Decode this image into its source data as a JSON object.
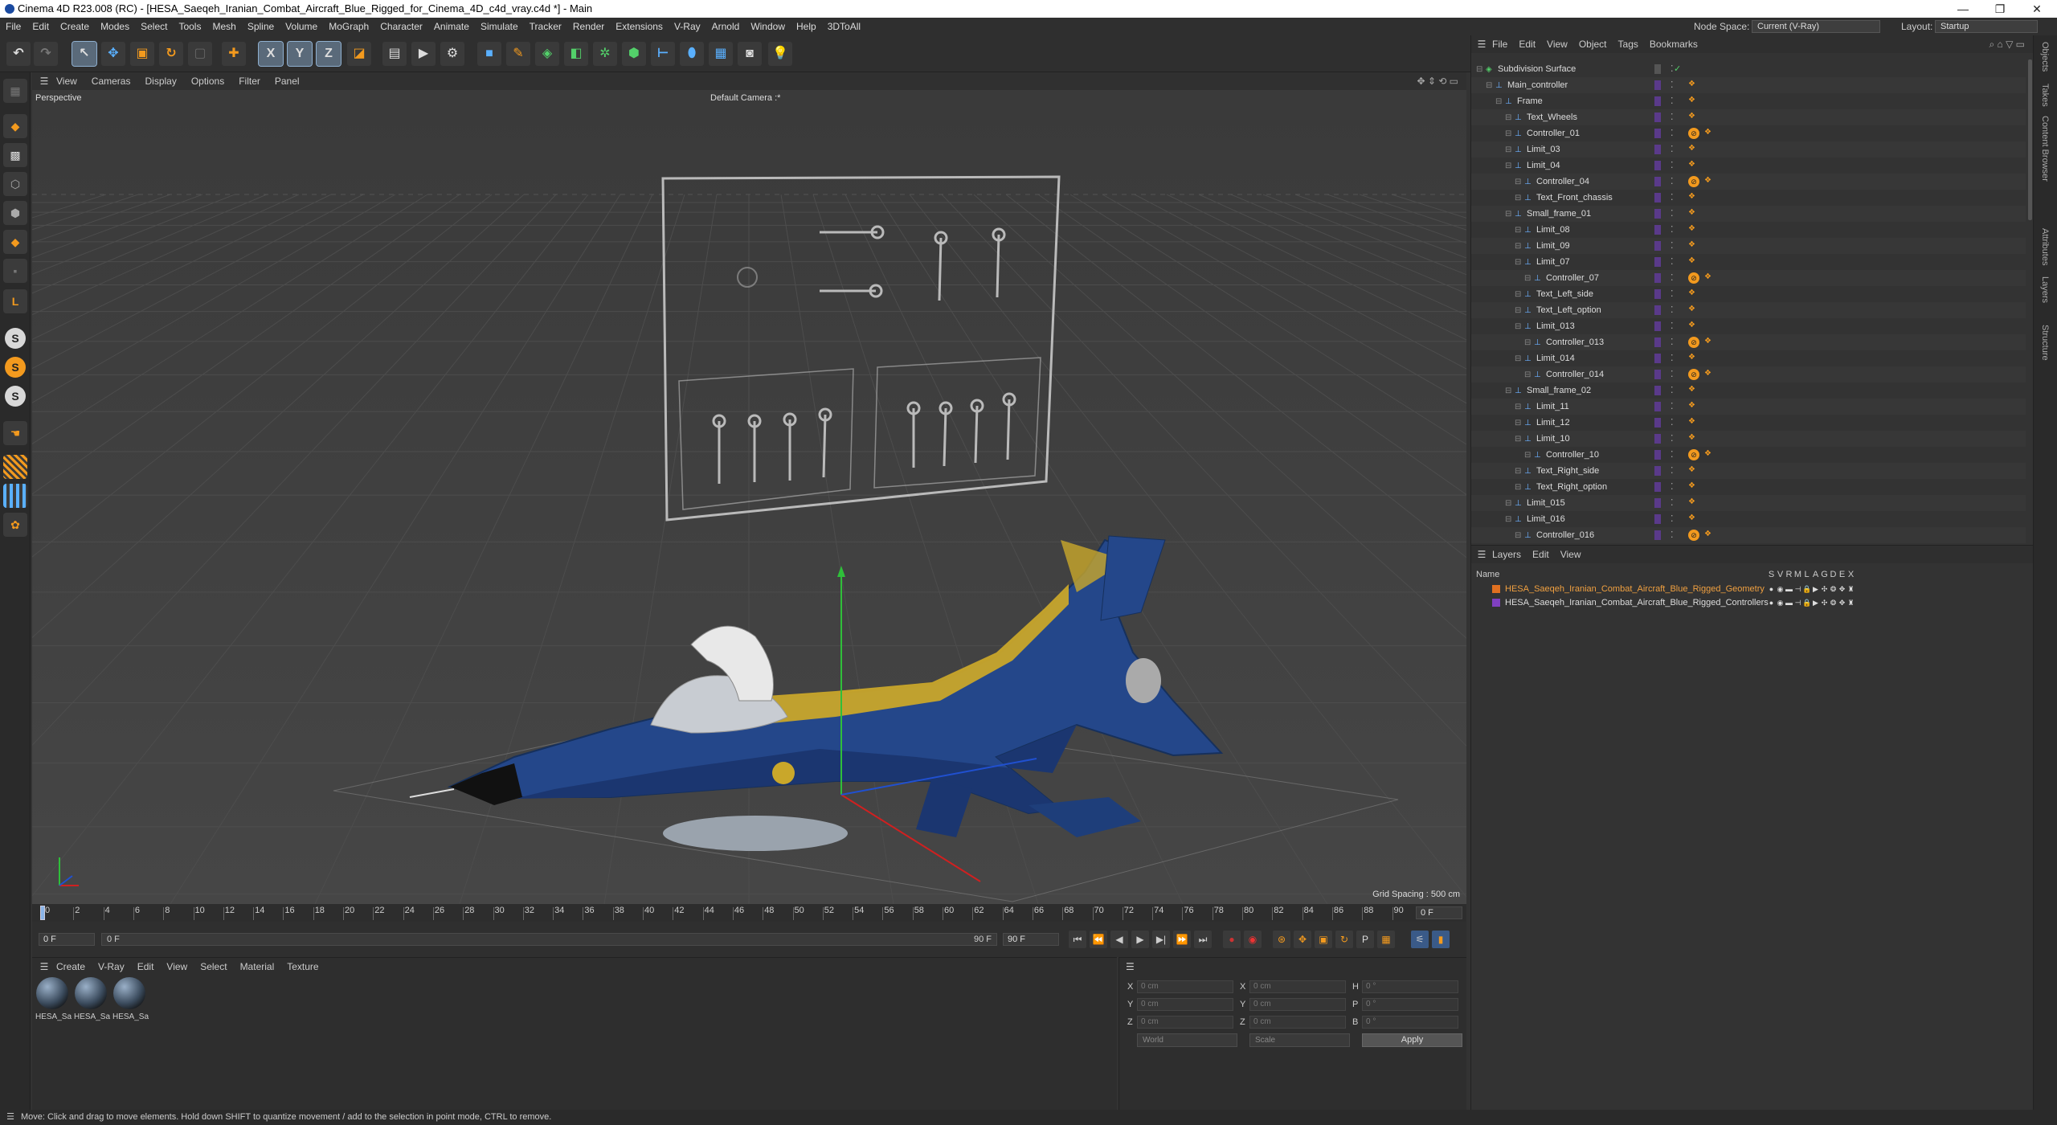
{
  "window": {
    "title": "Cinema 4D R23.008 (RC) - [HESA_Saeqeh_Iranian_Combat_Aircraft_Blue_Rigged_for_Cinema_4D_c4d_vray.c4d *] - Main",
    "minimize": "—",
    "maximize": "❐",
    "close": "✕"
  },
  "menu": {
    "items": [
      "File",
      "Edit",
      "Create",
      "Modes",
      "Select",
      "Tools",
      "Mesh",
      "Spline",
      "Volume",
      "MoGraph",
      "Character",
      "Animate",
      "Simulate",
      "Tracker",
      "Render",
      "Extensions",
      "V-Ray",
      "Arnold",
      "Window",
      "Help",
      "3DToAll"
    ],
    "node_space_label": "Node Space:",
    "node_space_value": "Current (V-Ray)",
    "layout_label": "Layout:",
    "layout_value": "Startup"
  },
  "viewport": {
    "menu": [
      "View",
      "Cameras",
      "Display",
      "Options",
      "Filter",
      "Panel"
    ],
    "view_name": "Perspective",
    "camera": "Default Camera :*",
    "grid_spacing": "Grid Spacing : 500 cm"
  },
  "timeline": {
    "ticks": [
      "0",
      "2",
      "4",
      "6",
      "8",
      "10",
      "12",
      "14",
      "16",
      "18",
      "20",
      "22",
      "24",
      "26",
      "28",
      "30",
      "32",
      "34",
      "36",
      "38",
      "40",
      "42",
      "44",
      "46",
      "48",
      "50",
      "52",
      "54",
      "56",
      "58",
      "60",
      "62",
      "64",
      "66",
      "68",
      "70",
      "72",
      "74",
      "76",
      "78",
      "80",
      "82",
      "84",
      "86",
      "88",
      "90"
    ],
    "current_frame": "0 F"
  },
  "transport": {
    "start": "0 F",
    "current": "0 F",
    "end": "90 F",
    "max": "90 F"
  },
  "materials": {
    "menu": [
      "Create",
      "V-Ray",
      "Edit",
      "View",
      "Select",
      "Material",
      "Texture"
    ],
    "items": [
      "HESA_Sa",
      "HESA_Sa",
      "HESA_Sa"
    ]
  },
  "coords": {
    "x_pos": "0 cm",
    "y_pos": "0 cm",
    "z_pos": "0 cm",
    "x_size": "0 cm",
    "y_size": "0 cm",
    "z_size": "0 cm",
    "h": "0 °",
    "p": "0 °",
    "b": "0 °",
    "labels": {
      "x": "X",
      "y": "Y",
      "z": "Z",
      "h": "H",
      "p": "P",
      "b": "B"
    },
    "dropdown1": "World",
    "dropdown2": "Scale",
    "apply": "Apply"
  },
  "status": "Move: Click and drag to move elements. Hold down SHIFT to quantize movement / add to the selection in point mode, CTRL to remove.",
  "objects": {
    "menu": [
      "File",
      "Edit",
      "View",
      "Object",
      "Tags",
      "Bookmarks"
    ],
    "tree": [
      {
        "name": "Subdivision Surface",
        "indent": 0,
        "tag": "none"
      },
      {
        "name": "Main_controller",
        "indent": 1,
        "tag": "dot"
      },
      {
        "name": "Frame",
        "indent": 2,
        "tag": "dot"
      },
      {
        "name": "Text_Wheels",
        "indent": 3,
        "tag": "dot"
      },
      {
        "name": "Controller_01",
        "indent": 3,
        "tag": "icon"
      },
      {
        "name": "Limit_03",
        "indent": 3,
        "tag": "dot"
      },
      {
        "name": "Limit_04",
        "indent": 3,
        "tag": "dot"
      },
      {
        "name": "Controller_04",
        "indent": 4,
        "tag": "icon"
      },
      {
        "name": "Text_Front_chassis",
        "indent": 4,
        "tag": "dot"
      },
      {
        "name": "Small_frame_01",
        "indent": 3,
        "tag": "dot"
      },
      {
        "name": "Limit_08",
        "indent": 4,
        "tag": "dot"
      },
      {
        "name": "Limit_09",
        "indent": 4,
        "tag": "dot"
      },
      {
        "name": "Limit_07",
        "indent": 4,
        "tag": "dot"
      },
      {
        "name": "Controller_07",
        "indent": 5,
        "tag": "icon"
      },
      {
        "name": "Text_Left_side",
        "indent": 4,
        "tag": "dot"
      },
      {
        "name": "Text_Left_option",
        "indent": 4,
        "tag": "dot"
      },
      {
        "name": "Limit_013",
        "indent": 4,
        "tag": "dot"
      },
      {
        "name": "Controller_013",
        "indent": 5,
        "tag": "icon"
      },
      {
        "name": "Limit_014",
        "indent": 4,
        "tag": "dot"
      },
      {
        "name": "Controller_014",
        "indent": 5,
        "tag": "icon"
      },
      {
        "name": "Small_frame_02",
        "indent": 3,
        "tag": "dot"
      },
      {
        "name": "Limit_11",
        "indent": 4,
        "tag": "dot"
      },
      {
        "name": "Limit_12",
        "indent": 4,
        "tag": "dot"
      },
      {
        "name": "Limit_10",
        "indent": 4,
        "tag": "dot"
      },
      {
        "name": "Controller_10",
        "indent": 5,
        "tag": "icon"
      },
      {
        "name": "Text_Right_side",
        "indent": 4,
        "tag": "dot"
      },
      {
        "name": "Text_Right_option",
        "indent": 4,
        "tag": "dot"
      },
      {
        "name": "Limit_015",
        "indent": 3,
        "tag": "dot"
      },
      {
        "name": "Limit_016",
        "indent": 3,
        "tag": "dot"
      },
      {
        "name": "Controller_016",
        "indent": 4,
        "tag": "icon"
      }
    ]
  },
  "layers": {
    "menu": [
      "Layers",
      "Edit",
      "View"
    ],
    "header": {
      "name": "Name",
      "cols": [
        "S",
        "V",
        "R",
        "M",
        "L",
        "A",
        "G",
        "D",
        "E",
        "X"
      ]
    },
    "rows": [
      {
        "name": "HESA_Saeqeh_Iranian_Combat_Aircraft_Blue_Rigged_Geometry",
        "color": "#e07020",
        "text_color": "#f0a040"
      },
      {
        "name": "HESA_Saeqeh_Iranian_Combat_Aircraft_Blue_Rigged_Controllers",
        "color": "#8040c0",
        "text_color": "#dddddd"
      }
    ]
  },
  "right_tabs": [
    "Objects",
    "Takes",
    "Content Browser",
    "Attributes",
    "Layers",
    "Structure"
  ],
  "colors": {
    "accent": "#f39a1e",
    "select": "#5ab0ff",
    "panel": "#333333"
  }
}
